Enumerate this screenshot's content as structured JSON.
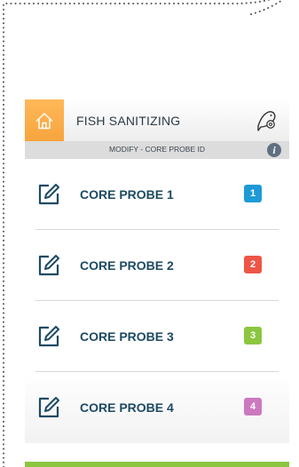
{
  "header": {
    "title": "FISH SANITIZING",
    "home_icon": "home-icon",
    "settings_icon": "fish-gear-icon",
    "accent_color": "#F7A43C"
  },
  "subheader": {
    "title": "MODIFY - CORE PROBE ID",
    "info_label": "i"
  },
  "probes": [
    {
      "label": "CORE PROBE 1",
      "number": "1",
      "color": "#1E9AD6",
      "edit_icon": "edit-icon"
    },
    {
      "label": "CORE PROBE 2",
      "number": "2",
      "color": "#EE5546",
      "edit_icon": "edit-icon"
    },
    {
      "label": "CORE PROBE 3",
      "number": "3",
      "color": "#8CC63F",
      "edit_icon": "edit-icon"
    },
    {
      "label": "CORE PROBE 4",
      "number": "4",
      "color": "#CC79BF",
      "edit_icon": "edit-icon"
    }
  ],
  "footer": {
    "bar_color": "#8CC63F"
  }
}
